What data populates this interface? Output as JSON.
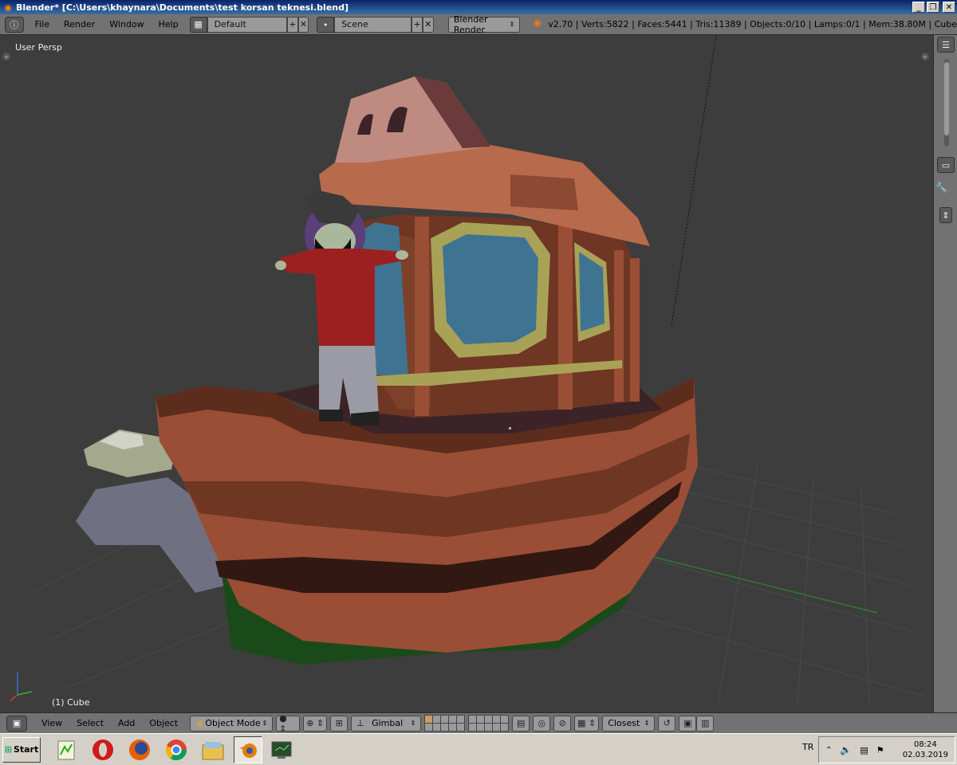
{
  "window": {
    "title": "Blender* [C:\\Users\\khaynara\\Documents\\test korsan teknesi.blend]",
    "minimize": "_",
    "maximize": "❐",
    "close": "✕"
  },
  "infobar": {
    "editor_icon": "ⓘ",
    "menus": [
      "File",
      "Render",
      "Window",
      "Help"
    ],
    "screen_layout": "Default",
    "scene": "Scene",
    "render_engine": "Blender Render",
    "stats": "v2.70 | Verts:5822 | Faces:5441 | Tris:11389 | Objects:0/10 | Lamps:0/1 | Mem:38.80M | Cube"
  },
  "viewport": {
    "view_name": "User Persp",
    "active_object": "(1) Cube"
  },
  "viewheader": {
    "menus": [
      "View",
      "Select",
      "Add",
      "Object"
    ],
    "mode": "Object Mode",
    "orientation": "Gimbal",
    "snap_target": "Closest"
  },
  "taskbar": {
    "start_label": "Start",
    "language": "TR",
    "time": "08:24",
    "date": "02.03.2019",
    "apps": [
      "notepad-chart-icon",
      "opera-icon",
      "firefox-icon",
      "chrome-icon",
      "file-explorer-icon",
      "blender-icon",
      "terminal-icon"
    ]
  },
  "colors": {
    "header_bg": "#727272",
    "viewport_bg": "#3d3d3d",
    "hull": "#9a4e35",
    "cabin": "#b86a4c",
    "windows": "#3f7392",
    "window_frame": "#a8a257"
  }
}
